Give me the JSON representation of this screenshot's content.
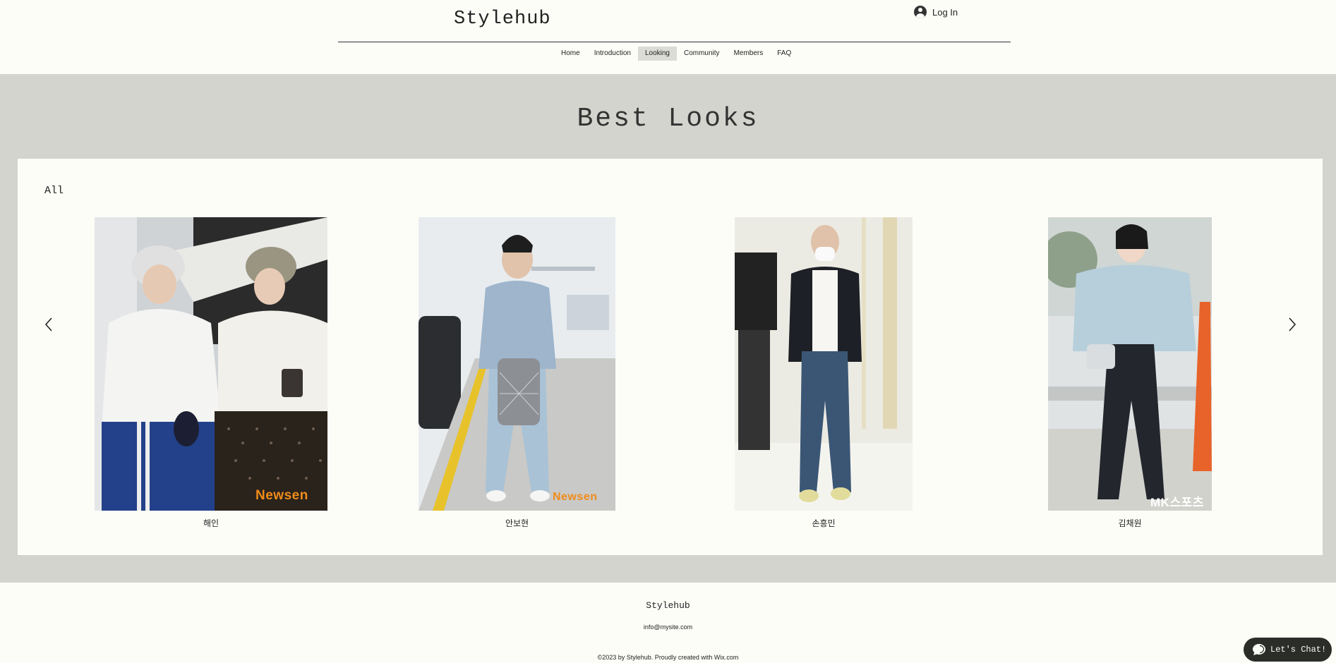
{
  "header": {
    "logo": "Stylehub",
    "login_label": "Log In",
    "nav": [
      {
        "label": "Home",
        "active": false
      },
      {
        "label": "Introduction",
        "active": false
      },
      {
        "label": "Looking",
        "active": true
      },
      {
        "label": "Community",
        "active": false
      },
      {
        "label": "Members",
        "active": false
      },
      {
        "label": "FAQ",
        "active": false
      }
    ]
  },
  "main": {
    "title": "Best Looks",
    "filter_label": "All",
    "prev_icon": "chevron-left-icon",
    "next_icon": "chevron-right-icon",
    "gallery": [
      {
        "caption": "해인",
        "watermark": "Newsen"
      },
      {
        "caption": "안보현",
        "watermark": "Newsen"
      },
      {
        "caption": "손흥민",
        "watermark": ""
      },
      {
        "caption": "김채원",
        "watermark": "MK스포츠"
      }
    ]
  },
  "footer": {
    "brand": "Stylehub",
    "email": "info@mysite.com",
    "copyright": "©2023 by Stylehub. Proudly created with Wix.com"
  },
  "chat": {
    "label": "Let's Chat!",
    "icon": "chat-bubble-icon"
  },
  "colors": {
    "page_bg": "#fdfdf8",
    "band_bg": "#d3d4ce",
    "nav_active_bg": "#dcdcd6",
    "chat_bg": "#2a2d28"
  }
}
